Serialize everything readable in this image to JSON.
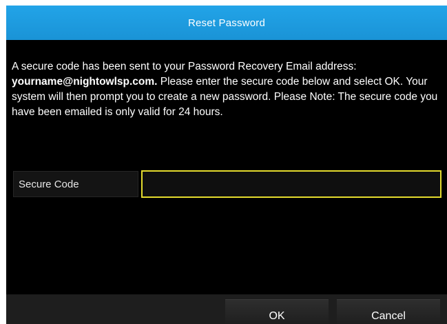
{
  "dialog": {
    "title": "Reset Password",
    "message_part1": "A secure code has been sent to your Password Recovery Email address: ",
    "email": "yourname@nightowlsp.com.",
    "message_part2": " Please enter the secure code below and select OK.  Your system will then prompt you to create a new password. Please Note: The secure code you have been emailed is only valid for 24 hours.",
    "field": {
      "label": "Secure Code",
      "value": "",
      "placeholder": ""
    },
    "buttons": {
      "ok_label": "OK",
      "cancel_label": "Cancel"
    }
  },
  "colors": {
    "titlebar": "#1a93d6",
    "background": "#000000",
    "input_focus_border": "#e5dc2e",
    "text": "#ffffff"
  }
}
